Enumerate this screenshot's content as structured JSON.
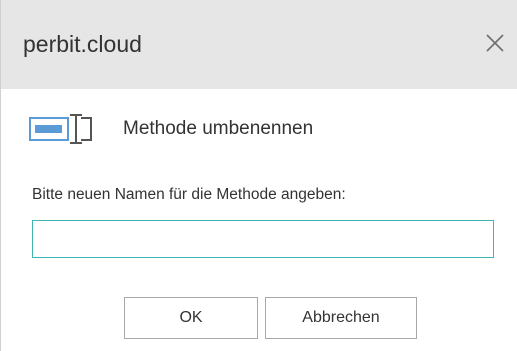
{
  "dialog": {
    "title": "perbit.cloud",
    "close_icon": "close-icon",
    "header_icon": "rename-field-icon",
    "header_text": "Methode umbenennen",
    "prompt_label": "Bitte neuen Namen für die Methode angeben:",
    "input": {
      "value": "",
      "placeholder": ""
    },
    "ok_label": "OK",
    "cancel_label": "Abbrechen"
  },
  "colors": {
    "titlebar_bg": "#e6e6e6",
    "input_border_focus": "#3fb5b5",
    "icon_accent": "#5b9bd5",
    "text": "#333333"
  }
}
